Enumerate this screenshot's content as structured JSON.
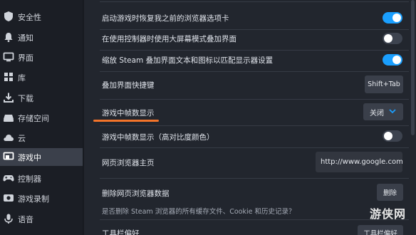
{
  "sidebar": {
    "items": [
      {
        "label": "安全性",
        "icon": "shield-icon"
      },
      {
        "label": "通知",
        "icon": "bell-icon"
      },
      {
        "label": "界面",
        "icon": "monitor-icon"
      },
      {
        "label": "库",
        "icon": "grid-icon"
      },
      {
        "label": "下载",
        "icon": "download-icon"
      },
      {
        "label": "存储空间",
        "icon": "drive-icon"
      },
      {
        "label": "云",
        "icon": "cloud-icon"
      },
      {
        "label": "游戏中",
        "icon": "game-overlay-icon",
        "active": true
      },
      {
        "label": "控制器",
        "icon": "controller-icon"
      },
      {
        "label": "游戏录制",
        "icon": "record-icon"
      },
      {
        "label": "语音",
        "icon": "microphone-icon"
      }
    ]
  },
  "settings": {
    "restore_tabs": {
      "label": "启动游戏时恢复我之前的浏览器选项卡",
      "enabled": true
    },
    "bigpicture_overlay": {
      "label": "在使用控制器时使用大屏幕模式叠加界面",
      "enabled": false
    },
    "scale_overlay": {
      "label": "缩放 Steam 叠加界面文本和图标以匹配显示器设置",
      "enabled": true
    },
    "overlay_shortcut": {
      "label": "叠加界面快捷键",
      "value": "Shift+Tab"
    },
    "fps_counter": {
      "label": "游戏中帧数显示",
      "value": "关闭"
    },
    "fps_high_contrast": {
      "label": "游戏中帧数显示（高对比度颜色）",
      "enabled": false
    },
    "browser_home": {
      "label": "网页浏览器主页",
      "value": "http://www.google.com"
    },
    "delete_browser_data": {
      "label": "删除网页浏览器数据",
      "button": "删除",
      "description": "是否删除 Steam 浏览器的所有缓存文件、Cookie 和历史记录？"
    },
    "toolbar_prefs": {
      "label": "工具栏偏好",
      "button": "工具栏偏好"
    }
  },
  "watermark": {
    "text": "游侠网"
  },
  "colors": {
    "accent": "#1a9fff",
    "highlight": "#f4742a"
  }
}
